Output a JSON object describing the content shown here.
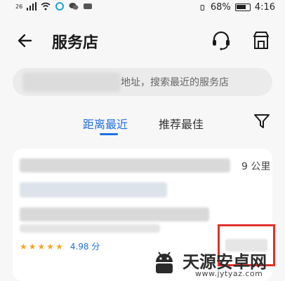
{
  "statusbar": {
    "signal": "26",
    "battery": "68%",
    "time": "4:16"
  },
  "header": {
    "title": "服务店",
    "back_icon": "arrow-left-icon",
    "headset_icon": "headset-icon",
    "store_icon": "store-icon"
  },
  "search": {
    "placeholder_visible": "地址，搜索最近的服务店"
  },
  "tabs": [
    {
      "label": "距离最近",
      "active": true
    },
    {
      "label": "推荐最佳",
      "active": false
    }
  ],
  "filter_icon": "filter-icon",
  "result": {
    "distance": "9 公里",
    "rating": 4.98,
    "rating_label": "4.98 分",
    "stars": 5
  },
  "watermark": {
    "name": "天源安卓网",
    "url": "www.jytyaz.com"
  },
  "colors": {
    "accent": "#1f6fe5",
    "star": "#f5a623",
    "highlight": "#e0302b"
  }
}
